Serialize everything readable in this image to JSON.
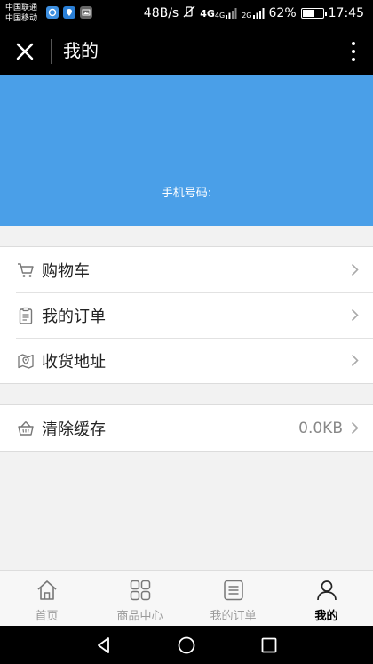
{
  "status_bar": {
    "carrier_1": "中国联通",
    "carrier_2": "中国移动",
    "net_speed": "48B/s",
    "net_type_a": "4G",
    "net_type_b": "4G",
    "net_type_c": "2G",
    "battery_percent": "62%",
    "battery_level": 0.62,
    "time": "17:45"
  },
  "title_bar": {
    "title": "我的"
  },
  "header": {
    "phone_label": "手机号码:"
  },
  "menu": {
    "items": [
      {
        "label": "购物车",
        "icon": "cart-icon"
      },
      {
        "label": "我的订单",
        "icon": "clipboard-icon"
      },
      {
        "label": "收货地址",
        "icon": "map-pin-icon"
      }
    ],
    "clear_cache": {
      "label": "清除缓存",
      "value": "0.0KB",
      "icon": "basket-icon"
    }
  },
  "tabbar": {
    "tabs": [
      {
        "label": "首页",
        "icon": "home-icon",
        "active": false
      },
      {
        "label": "商品中心",
        "icon": "grid-icon",
        "active": false
      },
      {
        "label": "我的订单",
        "icon": "list-icon",
        "active": false
      },
      {
        "label": "我的",
        "icon": "user-icon",
        "active": true
      }
    ]
  },
  "colors": {
    "banner": "#4a9fe8",
    "bars": "#000000",
    "background": "#f2f2f2"
  }
}
